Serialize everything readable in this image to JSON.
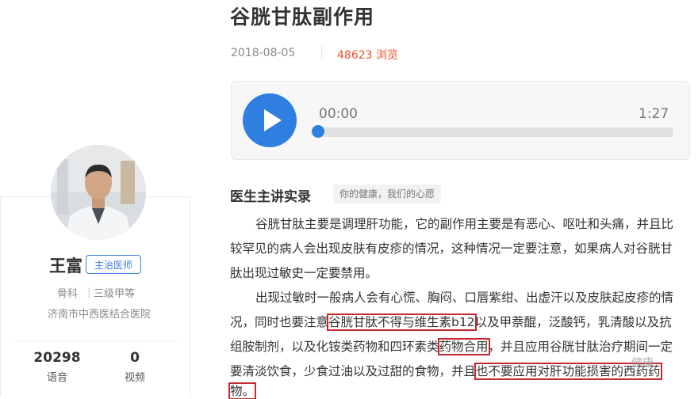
{
  "article": {
    "title": "谷胱甘肽副作用",
    "date": "2018-08-05",
    "views": "48623 浏览"
  },
  "player": {
    "current_time": "00:00",
    "total_time": "1:27",
    "progress": 0,
    "accent_color": "#2f7fe0",
    "play_icon": "play-icon"
  },
  "section": {
    "title": "医生主讲实录",
    "slogan": "你的健康，我们的心愿"
  },
  "content": {
    "p1": [
      "谷胱甘肽主要是调理肝功能，它的副作用主要是有恶心、呕吐和头痛，并且比",
      "较罕见的病人会出现皮肤有皮疹的情况，这种情况一定要注意，如果病人对谷胱甘",
      "肽出现过敏史一定要禁用。"
    ],
    "p2_line1": "出现过敏时一般病人会有心慌、胸闷、口唇紫绀、出虚汗以及皮肤起皮疹的情",
    "p2_line2_a": "况，同时也要注意",
    "p2_line2_hl": "谷胱甘肽不得与维生素b12",
    "p2_line2_b": "以及甲萘醌，泛酸钙，乳清酸以及抗",
    "p2_line3_a": "组胺制剂，以及化铵类药物和四环素类",
    "p2_line3_hl": "药物合用",
    "p2_line3_b": "，并且应用谷胱甘肽治疗期间一定",
    "p2_line4_a": "要清淡饮食，少食过油以及过甜的食物，并且",
    "p2_line4_hl": "也不要应用对肝功能损害的西药药",
    "p2_line5_hl": "物。",
    "highlight_color": "#c3292f"
  },
  "doctor": {
    "name": "王富",
    "title": "主治医师",
    "department": "骨科",
    "separator": "|",
    "level": "三级甲等",
    "hospital": "济南市中西医结合医院",
    "stats": {
      "audio_count": "20298",
      "audio_label": "语音",
      "video_count": "0",
      "video_label": "视频"
    }
  },
  "watermark": "健康"
}
